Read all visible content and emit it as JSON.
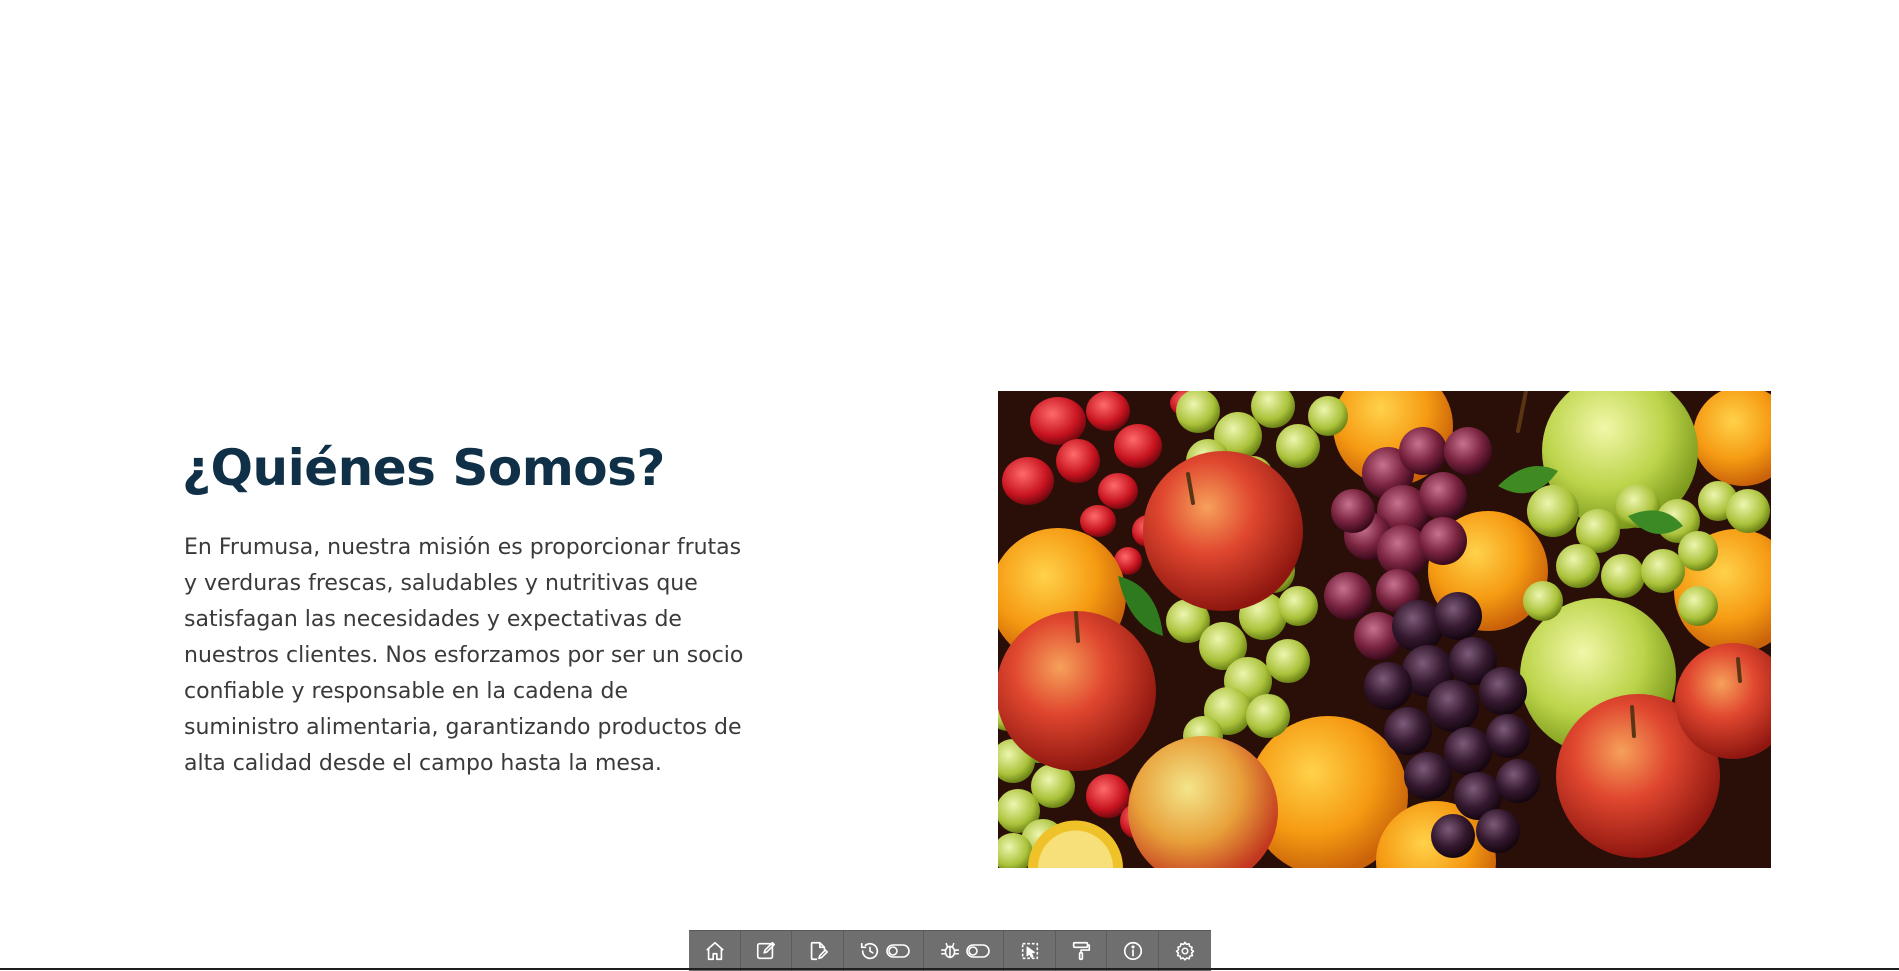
{
  "about": {
    "title": "¿Quiénes Somos?",
    "text": "En Frumusa, nuestra misión es proporcionar frutas y verduras frescas, saludables y nutritivas que satisfagan las necesidades y expectativas de nuestros clientes. Nos esforzamos por ser un socio confiable y responsable en la cadena de suministro alimentaria, garantizando productos de alta calidad desde el campo hasta la mesa."
  },
  "colors": {
    "title": "#0f3047",
    "body_text": "#3a3a3a",
    "toolbar_bg": "#6f6f6f",
    "toolbar_icon": "#ffffff"
  },
  "toolbar": {
    "buttons": [
      {
        "icon": "home-icon"
      },
      {
        "icon": "edit-icon"
      },
      {
        "icon": "edit-page-icon"
      },
      {
        "icon": "history-icon",
        "toggle": "toggle-icon"
      },
      {
        "icon": "bug-icon",
        "toggle": "toggle-icon"
      },
      {
        "icon": "select-element-icon"
      },
      {
        "icon": "paint-roller-icon"
      },
      {
        "icon": "info-icon"
      },
      {
        "icon": "settings-icon"
      }
    ]
  }
}
